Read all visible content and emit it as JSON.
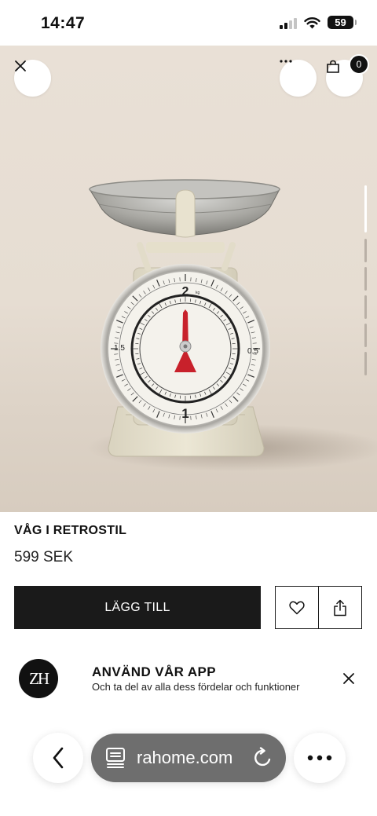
{
  "status_bar": {
    "time": "14:47",
    "battery": "59",
    "icons": [
      "signal-icon",
      "wifi-icon",
      "battery-icon"
    ]
  },
  "header": {
    "close_icon": "close-icon",
    "more_icon": "more-horizontal-icon",
    "bag_icon": "shopping-bag-icon",
    "bag_count": "0"
  },
  "product_image": {
    "dial_marks": [
      "2",
      "1",
      "1.5",
      "0.5",
      "kg"
    ]
  },
  "product": {
    "name": "VÅG I RETROSTIL",
    "price": "599 SEK"
  },
  "actions": {
    "add_to_cart": "LÄGG TILL",
    "wishlist_icon": "heart-icon",
    "share_icon": "share-icon"
  },
  "app_banner": {
    "logo_text": "ZH",
    "title": "ANVÄND VÅR APP",
    "subtitle": "Och ta del av alla dess fördelar och funktioner",
    "close_icon": "close-icon"
  },
  "browser": {
    "url": "rahome.com",
    "back_icon": "chevron-left-icon",
    "reader_icon": "reader-icon",
    "reload_icon": "reload-icon",
    "more_icon": "more-horizontal-icon"
  },
  "colors": {
    "button_dark": "#1a1a1a",
    "hero_background": "#e6ddd2",
    "url_pill": "#6e6e6e",
    "needle": "#c8212b"
  }
}
